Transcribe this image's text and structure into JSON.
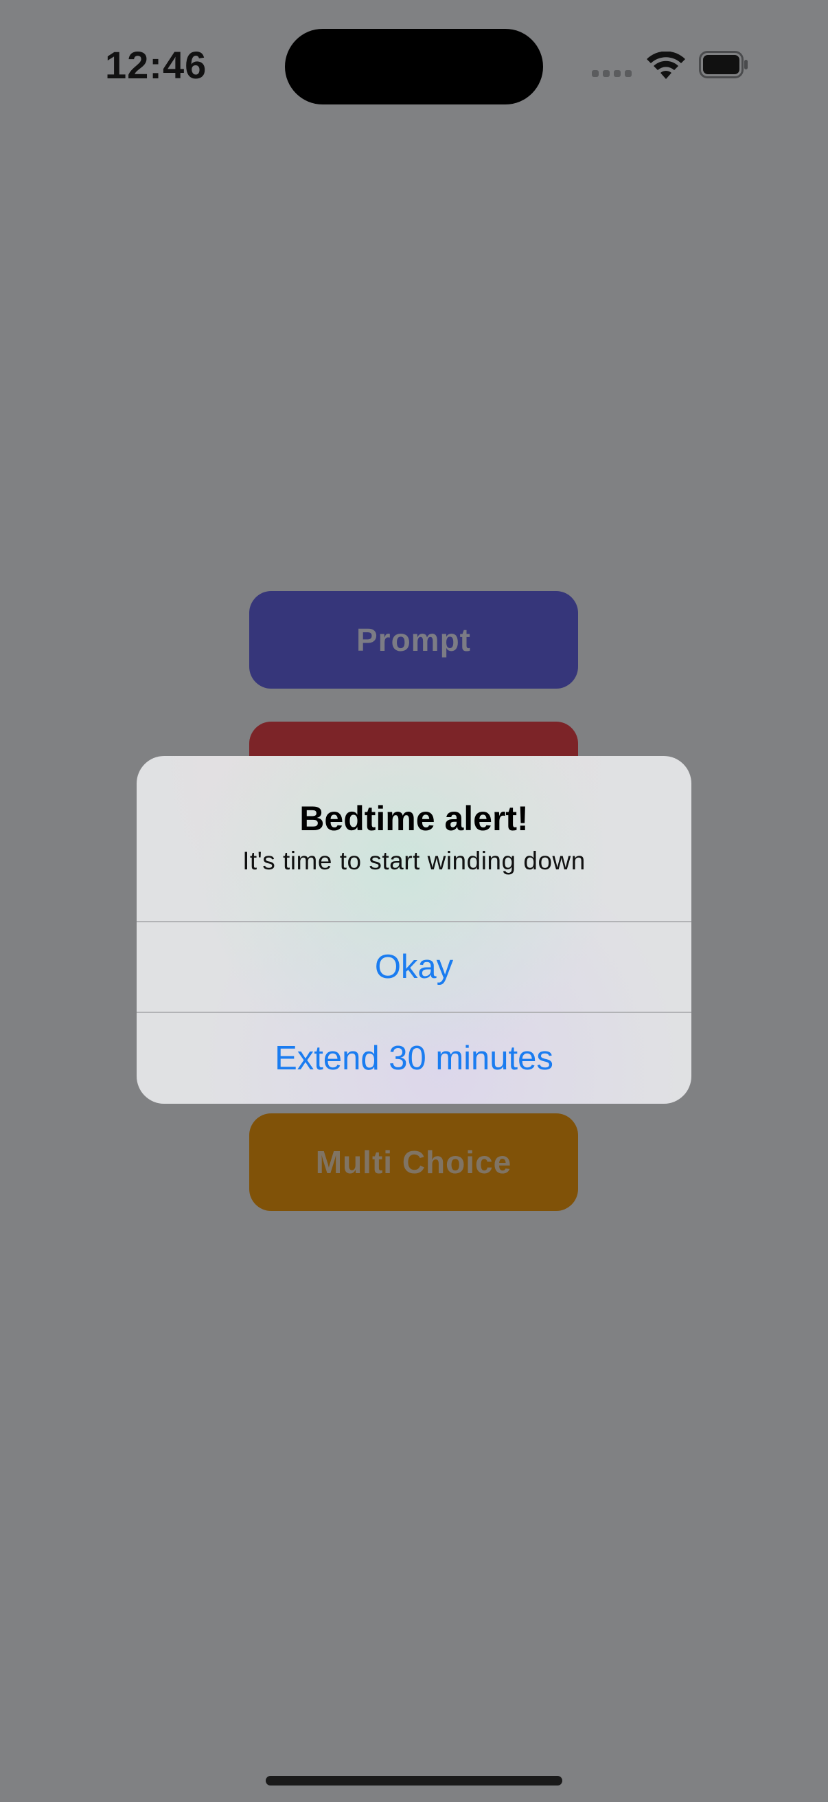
{
  "status_bar": {
    "time": "12:46",
    "icons": [
      "cellular-signal-icon",
      "wifi-icon",
      "battery-icon"
    ]
  },
  "buttons": {
    "prompt": "Prompt",
    "hidden_red": "",
    "multi_choice": "Multi Choice"
  },
  "alert": {
    "title": "Bedtime alert!",
    "message": "It's time to start winding down",
    "actions": [
      {
        "label": "Okay"
      },
      {
        "label": "Extend 30 minutes"
      }
    ]
  },
  "colors": {
    "overlay_background": "#808183",
    "prompt_button": "#36367a",
    "red_button": "#7c2428",
    "multi_choice_button": "#805208",
    "alert_action_text": "#1a7cf0"
  }
}
